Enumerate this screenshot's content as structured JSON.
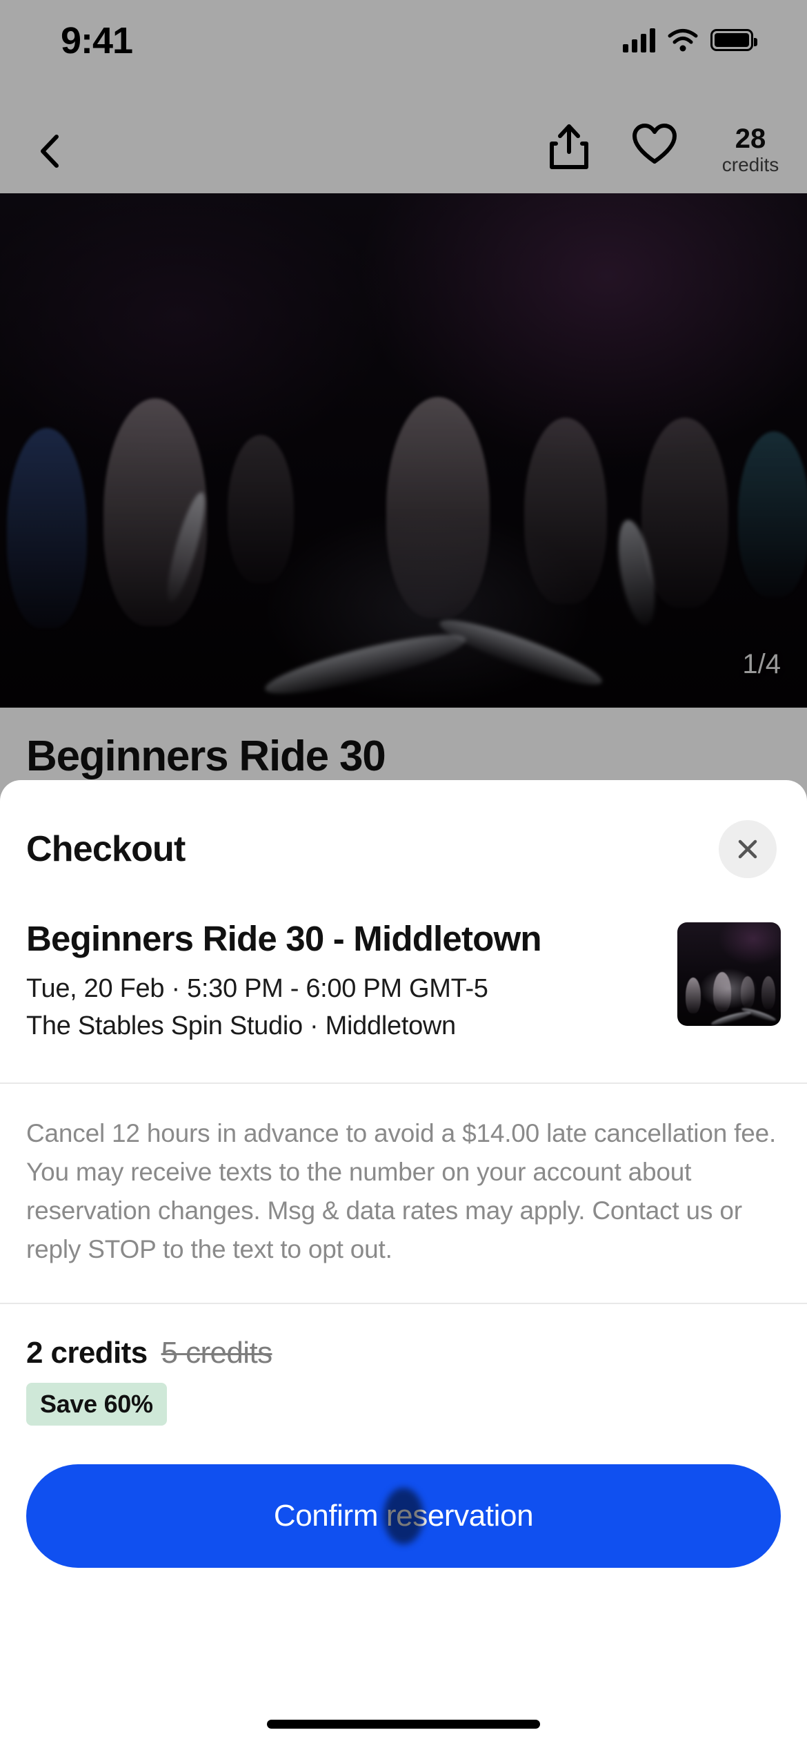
{
  "status_bar": {
    "time": "9:41",
    "cellular_icon": "cellular-signal-icon",
    "wifi_icon": "wifi-icon",
    "battery_icon": "battery-icon"
  },
  "nav_bar": {
    "back_icon": "chevron-left-icon",
    "share_icon": "share-icon",
    "favorite_icon": "heart-outline-icon",
    "credits_count": "28",
    "credits_label": "credits"
  },
  "hero": {
    "carousel_counter": "1/4",
    "background_title": "Beginners Ride 30"
  },
  "sheet": {
    "title": "Checkout",
    "close_icon": "close-x-icon",
    "class": {
      "name": "Beginners Ride 30 - Middletown",
      "datetime": "Tue, 20 Feb · 5:30 PM - 6:00 PM GMT-5",
      "venue": "The Stables Spin Studio · Middletown",
      "thumbnail_icon": "class-thumbnail-image"
    },
    "policy": "Cancel 12 hours in advance to avoid a $14.00 late cancellation fee. You may receive texts to the number on your account about reservation changes. Msg & data rates may apply. Contact us or reply STOP to the text to opt out.",
    "pricing": {
      "current_price": "2 credits",
      "original_price": "5 credits",
      "save_badge": "Save 60%"
    },
    "confirm_label": "Confirm reservation"
  },
  "colors": {
    "accent_blue": "#1050f0",
    "badge_green": "#cfe8d8",
    "divider": "#e8e8e8",
    "muted_text": "#8a8a8a"
  }
}
